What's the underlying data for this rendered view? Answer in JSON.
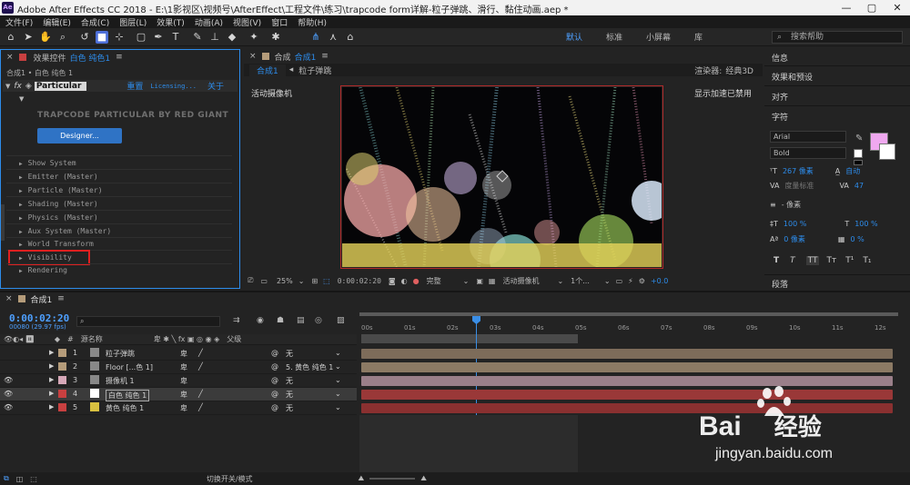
{
  "window": {
    "logo": "Ae",
    "title": "Adobe After Effects CC 2018 - E:\\1影视区\\视频号\\AfterEffect\\工程文件\\练习\\trapcode form详解-粒子弹跳、滑行、黏住动画.aep *",
    "minimize": "—",
    "maximize": "▢",
    "close": "✕"
  },
  "menu": [
    "文件(F)",
    "编辑(E)",
    "合成(C)",
    "图层(L)",
    "效果(T)",
    "动画(A)",
    "视图(V)",
    "窗口",
    "帮助(H)"
  ],
  "workspaces": [
    "默认",
    "标准",
    "小屏幕",
    "库"
  ],
  "search_help": "搜索帮助",
  "effects_panel": {
    "tab_prefix": "效果控件",
    "tab_layer": "白色 纯色1",
    "breadcrumb": "合成1 • 白色 纯色 1",
    "effect_name": "Particular",
    "reset": "重置",
    "licensing": "Licensing...",
    "about": "关于",
    "banner": "TRAPCODE PARTICULAR BY RED GIANT",
    "designer_button": "Designer...",
    "groups": [
      "Show System",
      "Emitter (Master)",
      "Particle (Master)",
      "Shading (Master)",
      "Physics (Master)",
      "Aux System (Master)",
      "World Transform",
      "Visibility",
      "Rendering"
    ]
  },
  "comp_panel": {
    "tab_prefix": "合成",
    "tab_name": "合成1",
    "subtab_active": "合成1",
    "subtab": "粒子弹跳",
    "renderer_label": "渲染器:",
    "renderer_value": "经典3D",
    "camera_label": "活动摄像机",
    "gpu_label": "显示加速已禁用",
    "zoom": "25%",
    "timecode": "0:00:02:20",
    "quality": "完整",
    "view": "活动摄像机",
    "views_count": "1个...",
    "exposure": "+0.0"
  },
  "right_panel": {
    "items": [
      "信息",
      "效果和预设",
      "对齐",
      "字符",
      "段落"
    ],
    "font": "Arial",
    "style": "Bold",
    "font_size": "267 像素",
    "leading": "自动",
    "kerning": "度量标准",
    "tracking": "47",
    "stroke": "- 像素",
    "v_scale": "100 %",
    "h_scale": "100 %",
    "baseline": "0 像素",
    "tsume": "0 %",
    "fill_color": "#f0a8f0",
    "style_buttons": [
      "T",
      "T",
      "TT",
      "Tт",
      "T¹",
      "T₁"
    ]
  },
  "timeline": {
    "tab": "合成1",
    "timecode": "0:00:02:20",
    "frame_info": "00080 (29.97 fps)",
    "col_source": "源名称",
    "col_parent": "父级",
    "ruler": [
      "00s",
      "01s",
      "02s",
      "03s",
      "04s",
      "05s",
      "06s",
      "07s",
      "08s",
      "09s",
      "10s",
      "11s",
      "12s"
    ],
    "layers": [
      {
        "num": "1",
        "name": "粒子弹跳",
        "parent": "无",
        "color": "#b59c7a",
        "bar": "#7d6c5a"
      },
      {
        "num": "2",
        "name": "Floor [...色 1]",
        "parent": "5. 黄色 纯色 1",
        "color": "#b59c7a",
        "bar": "#8c7a64"
      },
      {
        "num": "3",
        "name": "摄像机 1",
        "parent": "无",
        "color": "#d6a8b8",
        "bar": "#9a7f89"
      },
      {
        "num": "4",
        "name": "白色 纯色 1",
        "parent": "无",
        "color": "#c84040",
        "bar": "#9a3838"
      },
      {
        "num": "5",
        "name": "黄色 纯色 1",
        "parent": "无",
        "color": "#c84040",
        "bar": "#8a3030"
      }
    ],
    "footer_toggle": "切换开关/模式"
  },
  "watermark": {
    "brand_a": "Bai",
    "brand_b": "经验",
    "url": "jingyan.baidu.com"
  }
}
